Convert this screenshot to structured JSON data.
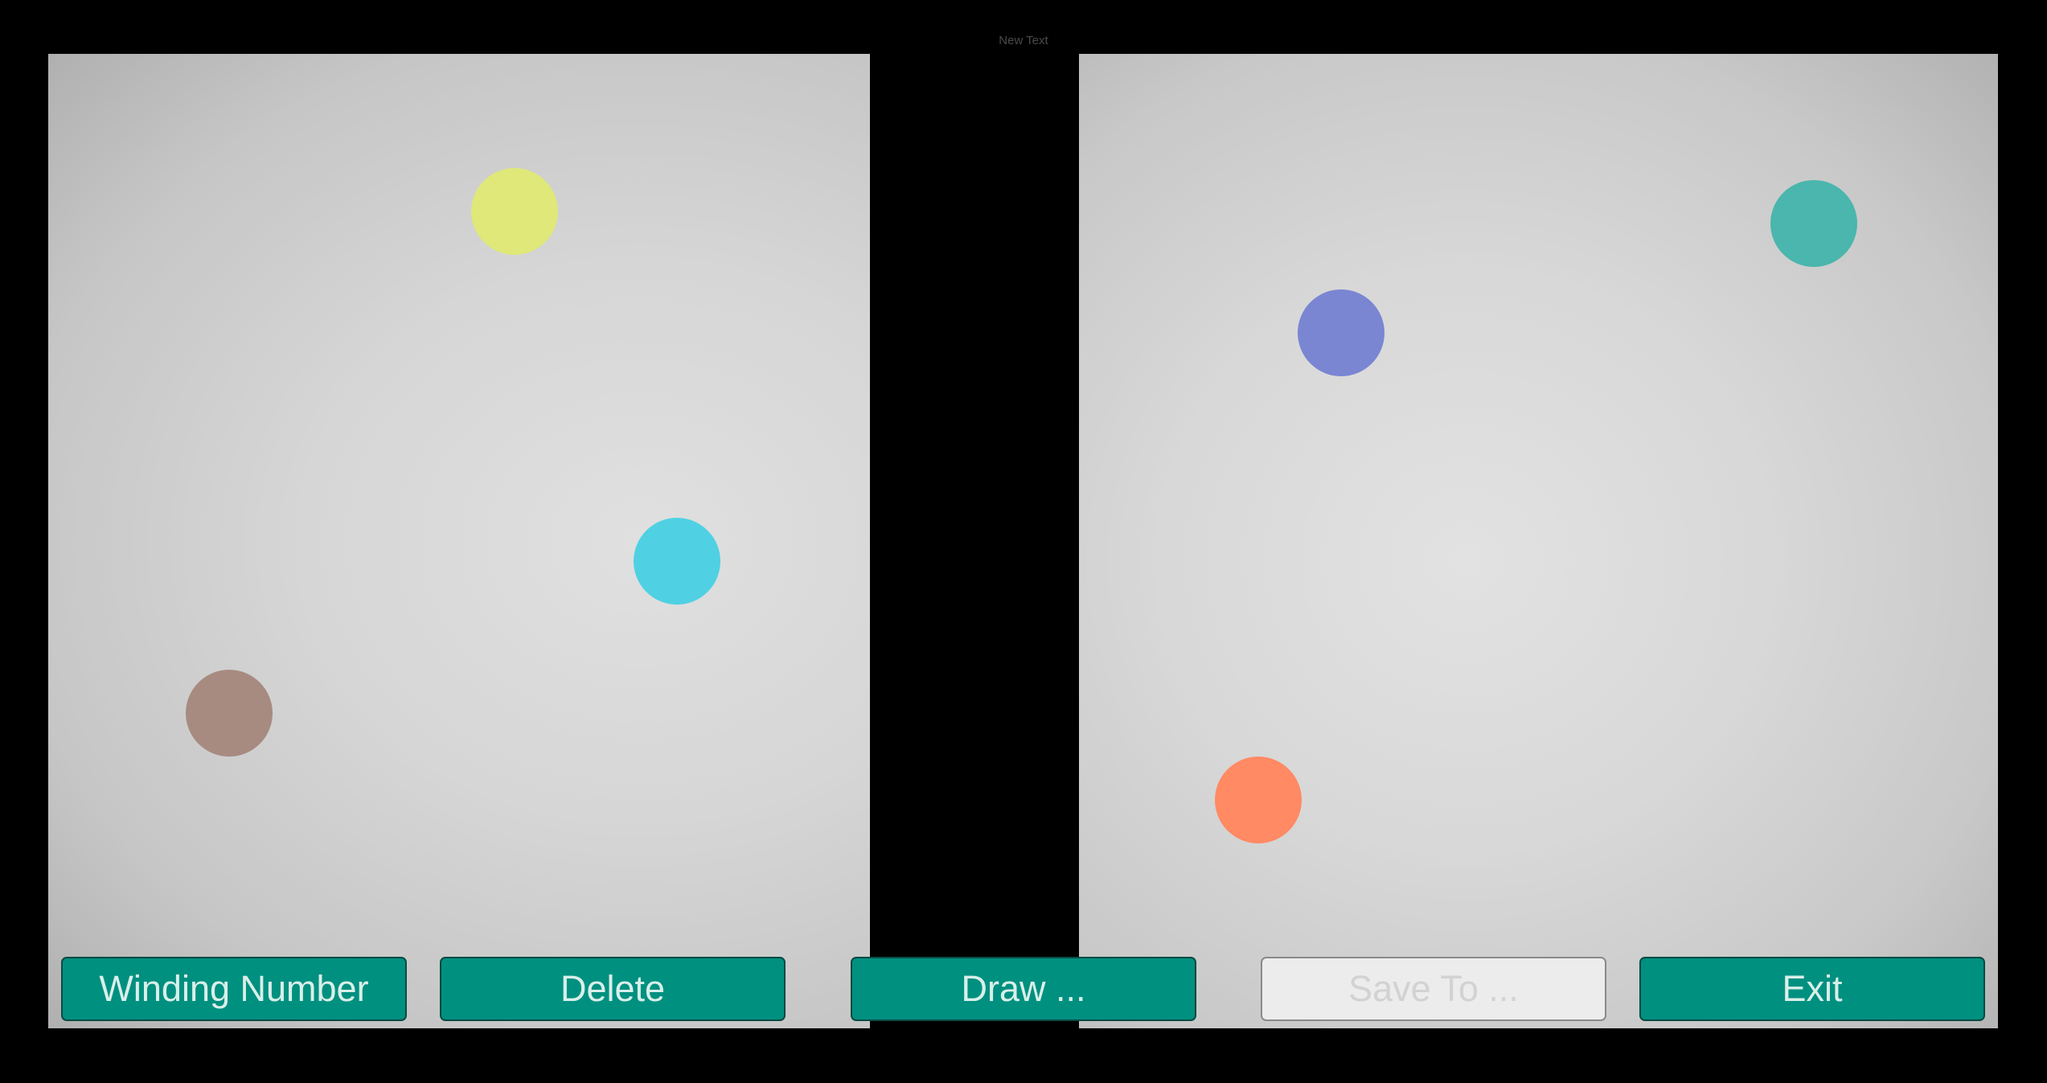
{
  "header": {
    "label": "New Text"
  },
  "left_panel": {
    "points": [
      {
        "name": "yellow",
        "color": "#dfe878"
      },
      {
        "name": "cyan",
        "color": "#4fd1e3"
      },
      {
        "name": "brown",
        "color": "#a78b80"
      }
    ]
  },
  "right_panel": {
    "points": [
      {
        "name": "teal",
        "color": "#4ab6ad"
      },
      {
        "name": "indigo",
        "color": "#7a86d2"
      },
      {
        "name": "orange",
        "color": "#ff8a64"
      }
    ]
  },
  "toolbar": {
    "winding_number_label": "Winding Number",
    "delete_label": "Delete",
    "draw_label": "Draw ...",
    "save_label": "Save To ...",
    "exit_label": "Exit"
  },
  "colors": {
    "button_bg": "#009080",
    "button_text": "#d9efe9",
    "disabled_bg": "#ececec",
    "disabled_text": "#d2d2d2",
    "background": "#000000"
  }
}
